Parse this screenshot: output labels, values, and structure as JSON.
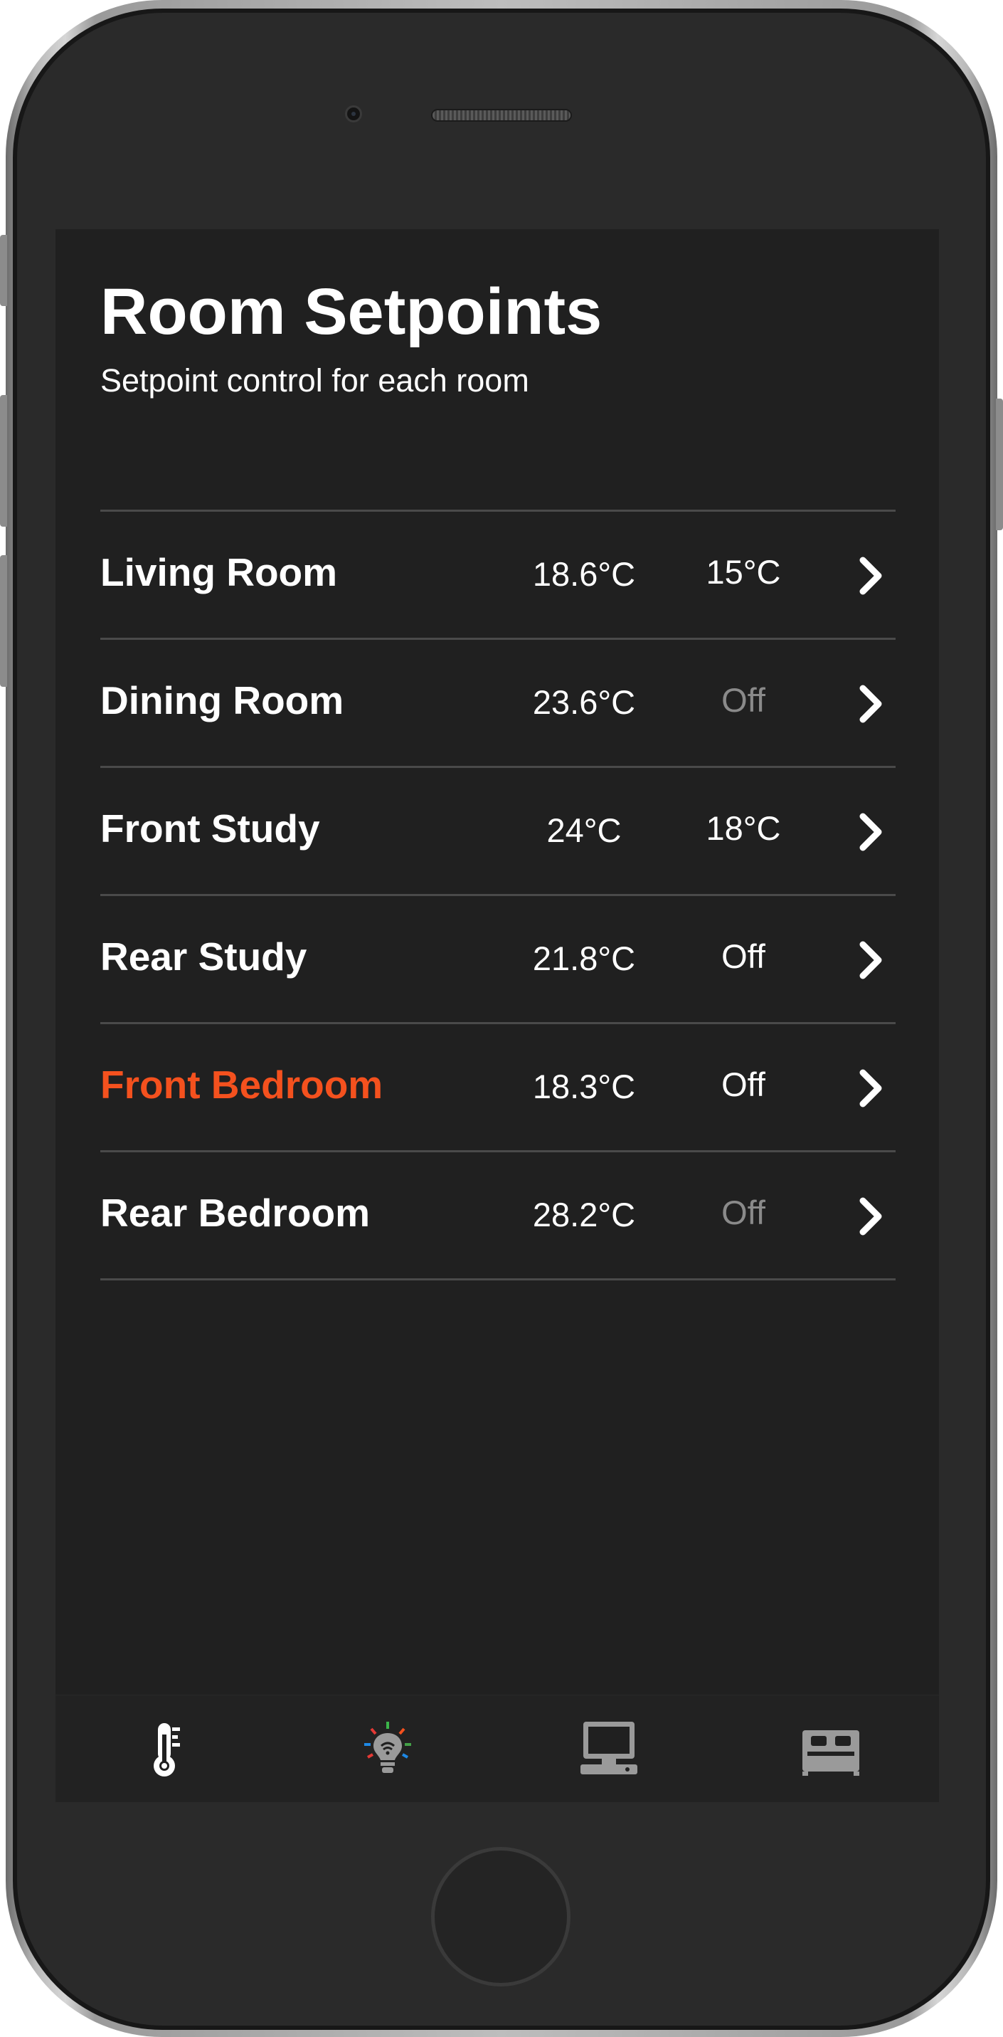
{
  "header": {
    "title": "Room Setpoints",
    "subtitle": "Setpoint control for each room"
  },
  "rooms": [
    {
      "name": "Living Room",
      "temperature": "18.6°C",
      "setpoint": "15°C",
      "setpoint_dimmed": false,
      "highlighted": false
    },
    {
      "name": "Dining Room",
      "temperature": "23.6°C",
      "setpoint": "Off",
      "setpoint_dimmed": true,
      "highlighted": false
    },
    {
      "name": "Front Study",
      "temperature": "24°C",
      "setpoint": "18°C",
      "setpoint_dimmed": false,
      "highlighted": false
    },
    {
      "name": "Rear Study",
      "temperature": "21.8°C",
      "setpoint": "Off",
      "setpoint_dimmed": false,
      "highlighted": false
    },
    {
      "name": "Front Bedroom",
      "temperature": "18.3°C",
      "setpoint": "Off",
      "setpoint_dimmed": false,
      "highlighted": true
    },
    {
      "name": "Rear Bedroom",
      "temperature": "28.2°C",
      "setpoint": "Off",
      "setpoint_dimmed": true,
      "highlighted": false
    }
  ],
  "row_chevron_icon": "chevron-right-icon",
  "tabbar": {
    "tabs": [
      {
        "icon": "thermometer-icon",
        "selected": true
      },
      {
        "icon": "smart-bulb-icon",
        "selected": false
      },
      {
        "icon": "computer-icon",
        "selected": false
      },
      {
        "icon": "bed-icon",
        "selected": false
      }
    ]
  },
  "colors": {
    "screen_background": "#202020",
    "text": "#ffffff",
    "highlight": "#f4511e",
    "dimmed_text": "#8a8a8a",
    "divider": "#4a4a4a",
    "inactive_icon": "#9a9a9a"
  }
}
